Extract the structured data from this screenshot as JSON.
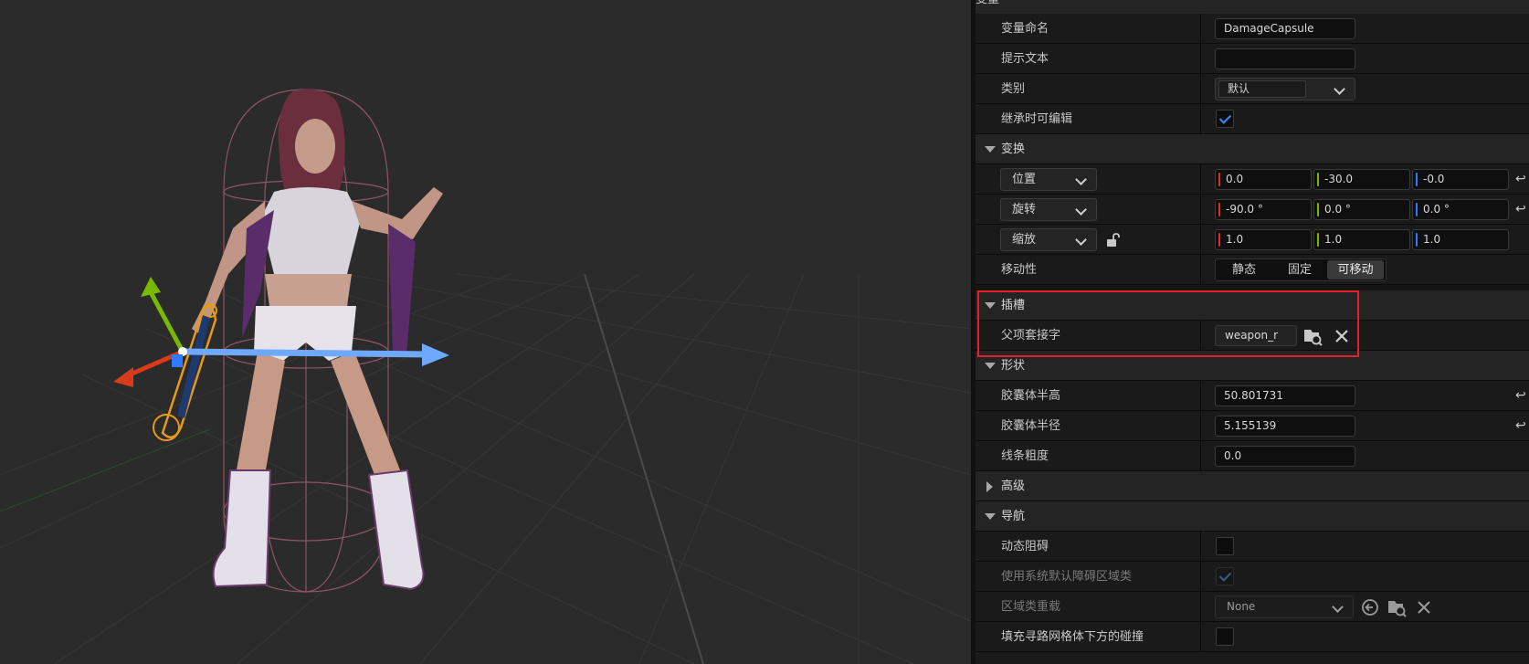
{
  "variables": {
    "section_label": "变量",
    "name_label": "变量命名",
    "name_value": "DamageCapsule",
    "tooltip_label": "提示文本",
    "tooltip_value": "",
    "category_label": "类别",
    "category_value": "默认",
    "editable_label": "继承时可编辑",
    "editable_checked": true
  },
  "transform": {
    "section_label": "变换",
    "location": {
      "mode": "位置",
      "x": "0.0",
      "y": "-30.0",
      "z": "-0.0"
    },
    "rotation": {
      "mode": "旋转",
      "x": "-90.0 °",
      "y": "0.0 °",
      "z": "0.0 °"
    },
    "scale": {
      "mode": "缩放",
      "x": "1.0",
      "y": "1.0",
      "z": "1.0"
    },
    "mobility_label": "移动性",
    "mobility_options": [
      "静态",
      "固定",
      "可移动"
    ],
    "mobility_selected": "可移动"
  },
  "sockets": {
    "section_label": "插槽",
    "parent_socket_label": "父项套接字",
    "parent_socket_value": "weapon_r"
  },
  "shape": {
    "section_label": "形状",
    "half_height_label": "胶囊体半高",
    "half_height_value": "50.801731",
    "radius_label": "胶囊体半径",
    "radius_value": "5.155139",
    "line_thickness_label": "线条粗度",
    "line_thickness_value": "0.0"
  },
  "advanced": {
    "section_label": "高级"
  },
  "navigation": {
    "section_label": "导航",
    "dynamic_obstacle_label": "动态阻碍",
    "use_default_area_label": "使用系统默认障碍区域类",
    "area_override_label": "区域类重载",
    "area_override_value": "None",
    "fill_collision_label": "填充寻路网格体下方的碰撞"
  },
  "colors": {
    "axis_x": "#e0311d",
    "axis_y": "#7ab800",
    "axis_z": "#2e7bff",
    "accent": "#2e8cff",
    "highlight": "#e0222c"
  }
}
